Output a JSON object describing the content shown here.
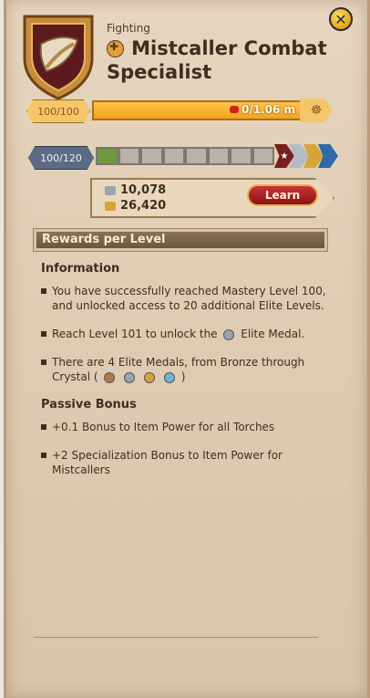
{
  "header": {
    "category": "Fighting",
    "title": "Mistcaller Combat Specialist",
    "close_icon": "close-x-icon"
  },
  "fame_bar": {
    "level": "100/100",
    "value_text": "0/1.06 m",
    "fill_fraction": 1.0
  },
  "mastery_bar": {
    "level": "100/120",
    "segments_total": 8,
    "segments_filled": 1
  },
  "currency": {
    "silver": "10,078",
    "gold": "26,420"
  },
  "learn_button": {
    "label": "Learn"
  },
  "rewards": {
    "title": "Rewards per Level",
    "information_heading": "Information",
    "info_items": [
      "You have successfully reached Mastery Level 100, and unlocked access to 20 additional Elite Levels.",
      "Reach Level 101 to unlock the",
      "Elite Medal.",
      "There are 4 Elite Medals, from Bronze through Crystal (",
      ")"
    ],
    "passive_heading": "Passive Bonus",
    "passive_items": [
      "+0.1 Bonus to Item Power for all Torches",
      "+2 Specialization Bonus to Item Power for Mistcallers"
    ]
  },
  "colors": {
    "bronze": "#b07a4a",
    "silver": "#9aa3ad",
    "gold": "#d7a33a",
    "crystal": "#6fb3d6",
    "progress_green": "#6c9a3c"
  }
}
